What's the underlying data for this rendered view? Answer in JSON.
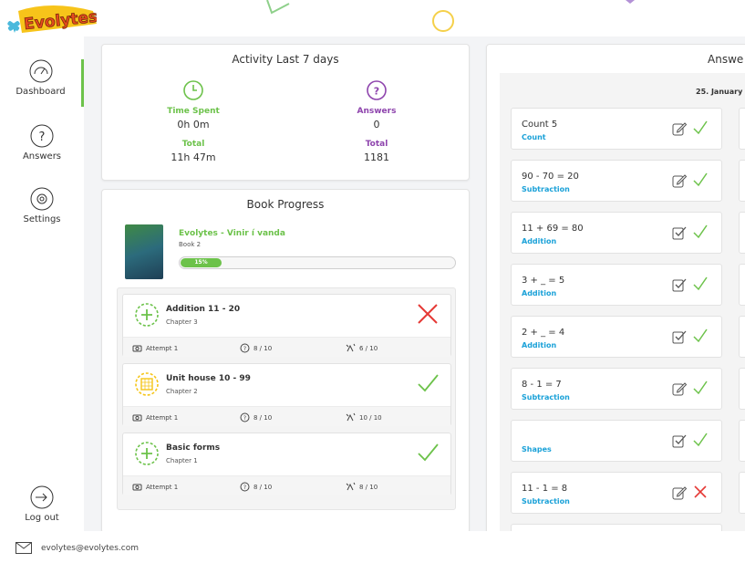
{
  "app": {
    "logo_text": "Evolytes"
  },
  "sidebar": {
    "items": [
      {
        "label": "Dashboard",
        "icon": "gauge-icon",
        "active": true
      },
      {
        "label": "Answers",
        "icon": "question-icon"
      },
      {
        "label": "Settings",
        "icon": "gear-icon"
      }
    ],
    "logout": {
      "label": "Log out",
      "icon": "logout-icon"
    }
  },
  "activity": {
    "title": "Activity Last 7 days",
    "time_spent": {
      "label": "Time Spent",
      "value": "0h 0m",
      "total_label": "Total",
      "total_value": "11h 47m"
    },
    "answers": {
      "label": "Answers",
      "value": "0",
      "total_label": "Total",
      "total_value": "1181"
    }
  },
  "book": {
    "title": "Book Progress",
    "name": "Evolytes - Vinir í vanda",
    "subtitle": "Book 2",
    "progress_label": "15%",
    "progress_fraction": 0.15,
    "chapters": [
      {
        "title": "Addition 11 - 20",
        "sub": "Chapter 3",
        "attempt": "Attempt 1",
        "answers": "8 / 10",
        "score": "6 / 10",
        "result": "incorrect"
      },
      {
        "title": "Unit house 10 - 99",
        "sub": "Chapter 2",
        "attempt": "Attempt 1",
        "answers": "8 / 10",
        "score": "10 / 10",
        "result": "correct"
      },
      {
        "title": "Basic forms",
        "sub": "Chapter 1",
        "attempt": "Attempt 1",
        "answers": "8 / 10",
        "score": "8 / 10",
        "result": "correct"
      }
    ]
  },
  "answers": {
    "title": "Answe",
    "date": "25. January",
    "items": [
      {
        "eq": "Count 5",
        "type": "Count",
        "edit": "pencil",
        "result": "correct"
      },
      {
        "eq": "90 - 70 = 20",
        "type": "Subtraction",
        "edit": "pencil",
        "result": "correct"
      },
      {
        "eq": "11 + 69 = 80",
        "type": "Addition",
        "edit": "check-box",
        "result": "correct"
      },
      {
        "eq": "3 + _ = 5",
        "type": "Addition",
        "edit": "check-box",
        "result": "correct"
      },
      {
        "eq": "2 + _ = 4",
        "type": "Addition",
        "edit": "check-box",
        "result": "correct"
      },
      {
        "eq": "8 - 1 = 7",
        "type": "Subtraction",
        "edit": "pencil",
        "result": "correct"
      },
      {
        "eq": "",
        "type": "Shapes",
        "edit": "check-box",
        "result": "correct"
      },
      {
        "eq": "11 - 1 = 8",
        "type": "Subtraction",
        "edit": "pencil",
        "result": "incorrect"
      }
    ]
  },
  "footer": {
    "email": "evolytes@evolytes.com"
  },
  "colors": {
    "green": "#6cc24a",
    "purple": "#8e44ad",
    "blue": "#1aa1d8",
    "red": "#e53935"
  }
}
